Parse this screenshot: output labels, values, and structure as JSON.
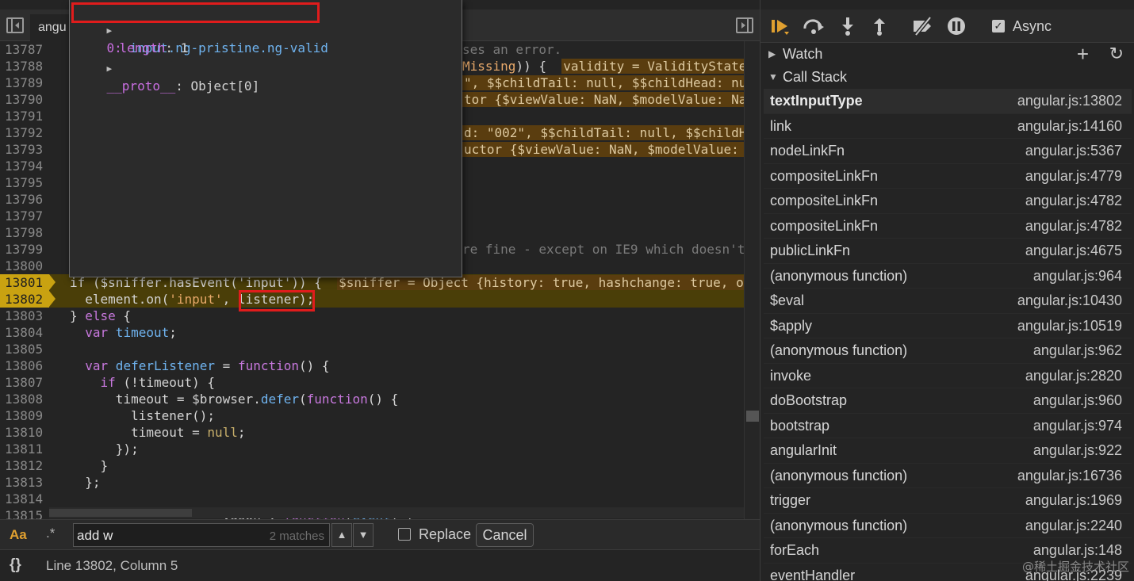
{
  "editor": {
    "tab_label": "angu",
    "lines": [
      {
        "n": "13787",
        "segs": []
      },
      {
        "n": "13788",
        "segs": []
      },
      {
        "n": "13789",
        "segs": []
      },
      {
        "n": "13790",
        "segs": []
      },
      {
        "n": "13791",
        "segs": []
      },
      {
        "n": "13792",
        "segs": []
      },
      {
        "n": "13793",
        "segs": []
      },
      {
        "n": "13794",
        "segs": []
      },
      {
        "n": "13795",
        "segs": []
      },
      {
        "n": "13796",
        "segs": []
      },
      {
        "n": "13797",
        "segs": []
      },
      {
        "n": "13798",
        "segs": []
      },
      {
        "n": "13799",
        "segs": []
      },
      {
        "n": "13800",
        "segs": []
      },
      {
        "n": "13801",
        "exec": true,
        "segs": [
          [
            "",
            "if ($sniffer.hasEvent('input')) {  "
          ],
          [
            "inl",
            "$sniffer = Object {history: true, hashchange: true, o"
          ]
        ]
      },
      {
        "n": "13802",
        "exec": true,
        "segs": [
          [
            "",
            "  element.on("
          ],
          [
            "st",
            "'input'"
          ],
          [
            "",
            ", listener);"
          ]
        ]
      },
      {
        "n": "13803",
        "segs": [
          [
            "",
            "} "
          ],
          [
            "kw",
            "else"
          ],
          [
            "",
            " {"
          ]
        ]
      },
      {
        "n": "13804",
        "segs": [
          [
            "",
            "  "
          ],
          [
            "kw",
            "var"
          ],
          [
            "fn",
            " timeout"
          ],
          [
            "",
            ";"
          ]
        ]
      },
      {
        "n": "13805",
        "segs": []
      },
      {
        "n": "13806",
        "segs": [
          [
            "",
            "  "
          ],
          [
            "kw",
            "var"
          ],
          [
            "fn",
            " deferListener"
          ],
          [
            "",
            " = "
          ],
          [
            "kw",
            "function"
          ],
          [
            "",
            "() {"
          ]
        ]
      },
      {
        "n": "13807",
        "segs": [
          [
            "",
            "    "
          ],
          [
            "kw",
            "if"
          ],
          [
            "",
            " (!timeout) {"
          ]
        ]
      },
      {
        "n": "13808",
        "segs": [
          [
            "",
            "      timeout = $browser."
          ],
          [
            "fn",
            "defer"
          ],
          [
            "",
            "("
          ],
          [
            "kw",
            "function"
          ],
          [
            "",
            "() {"
          ]
        ]
      },
      {
        "n": "13809",
        "segs": [
          [
            "",
            "        listener();"
          ]
        ]
      },
      {
        "n": "13810",
        "segs": [
          [
            "",
            "        timeout = "
          ],
          [
            "nu",
            "null"
          ],
          [
            "",
            ";"
          ]
        ]
      },
      {
        "n": "13811",
        "segs": [
          [
            "",
            "      });"
          ]
        ]
      },
      {
        "n": "13812",
        "segs": [
          [
            "",
            "    }"
          ]
        ]
      },
      {
        "n": "13813",
        "segs": [
          [
            "",
            "  };"
          ]
        ]
      },
      {
        "n": "13814",
        "segs": []
      },
      {
        "n": "13815",
        "segs": [
          [
            "",
            "                    ydown', "
          ],
          [
            "kw",
            "function"
          ],
          [
            "",
            "("
          ],
          [
            "fn",
            "event"
          ],
          [
            "",
            ") {"
          ]
        ]
      }
    ],
    "right_fragments": [
      {
        "line": 0,
        "segs": [
          [
            "cm",
            "ses an error."
          ]
        ]
      },
      {
        "line": 1,
        "segs": [
          [
            "st",
            "Missing"
          ],
          [
            "",
            ")) {  "
          ],
          [
            "inl",
            "validity = ValidityState {v"
          ]
        ]
      },
      {
        "line": 2,
        "segs": [
          [
            "inl",
            "\", $$childTail: null, $$childHead: nul"
          ]
        ]
      },
      {
        "line": 3,
        "segs": [
          [
            "inl",
            "tor {$viewValue: NaN, $modelValue: NaN,"
          ]
        ]
      },
      {
        "line": 5,
        "segs": [
          [
            "inl",
            "d: \"002\", $$childTail: null, $$childHe"
          ]
        ]
      },
      {
        "line": 6,
        "segs": [
          [
            "inl",
            "uctor {$viewValue: NaN, $modelValue: Na"
          ]
        ]
      },
      {
        "line": 12,
        "segs": [
          [
            "cm",
            "re fine - except on IE9 which doesn't"
          ]
        ]
      }
    ]
  },
  "popover": {
    "item0_key": "0",
    "item0_value": "input.ng-pristine.ng-valid",
    "length_key": "length",
    "length_value": "1",
    "proto_key": "__proto__",
    "proto_value": "Object[0]"
  },
  "search": {
    "case_label": "Aa",
    "regex_label": ".*",
    "query": "add w",
    "match_count": "2 matches",
    "replace_label": "Replace",
    "cancel_label": "Cancel"
  },
  "status": {
    "braces": "{}",
    "position": "Line 13802, Column 5"
  },
  "debugger": {
    "async_label": "Async",
    "watch_label": "Watch",
    "callstack_label": "Call Stack",
    "frames": [
      {
        "name": "textInputType",
        "loc": "angular.js:13802"
      },
      {
        "name": "link",
        "loc": "angular.js:14160"
      },
      {
        "name": "nodeLinkFn",
        "loc": "angular.js:5367"
      },
      {
        "name": "compositeLinkFn",
        "loc": "angular.js:4779"
      },
      {
        "name": "compositeLinkFn",
        "loc": "angular.js:4782"
      },
      {
        "name": "compositeLinkFn",
        "loc": "angular.js:4782"
      },
      {
        "name": "publicLinkFn",
        "loc": "angular.js:4675"
      },
      {
        "name": "(anonymous function)",
        "loc": "angular.js:964"
      },
      {
        "name": "$eval",
        "loc": "angular.js:10430"
      },
      {
        "name": "$apply",
        "loc": "angular.js:10519"
      },
      {
        "name": "(anonymous function)",
        "loc": "angular.js:962"
      },
      {
        "name": "invoke",
        "loc": "angular.js:2820"
      },
      {
        "name": "doBootstrap",
        "loc": "angular.js:960"
      },
      {
        "name": "bootstrap",
        "loc": "angular.js:974"
      },
      {
        "name": "angularInit",
        "loc": "angular.js:922"
      },
      {
        "name": "(anonymous function)",
        "loc": "angular.js:16736"
      },
      {
        "name": "trigger",
        "loc": "angular.js:1969"
      },
      {
        "name": "(anonymous function)",
        "loc": "angular.js:2240"
      },
      {
        "name": "forEach",
        "loc": "angular.js:148"
      },
      {
        "name": "eventHandler",
        "loc": "angular.js:2239"
      }
    ]
  },
  "watermark": "@稀土掘金技术社区",
  "colors": {
    "accent": "#e0a030",
    "exec_line": "#c9a211",
    "highlight_box": "#e01c1c"
  }
}
